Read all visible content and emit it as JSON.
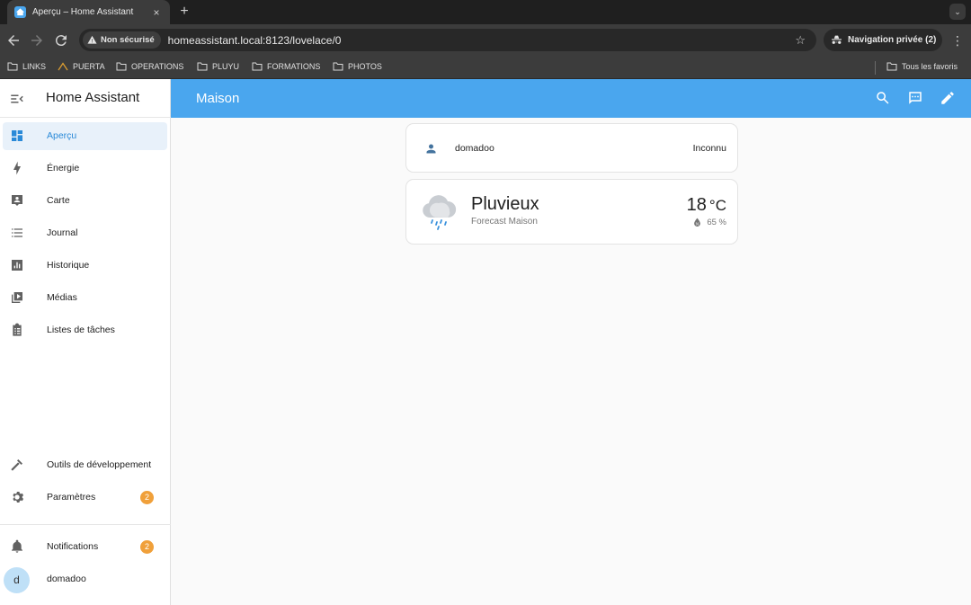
{
  "browser": {
    "tab_title": "Aperçu – Home Assistant",
    "tab_close": "×",
    "new_tab": "+",
    "security_label": "Non sécurisé",
    "url": "homeassistant.local:8123/lovelace/0",
    "private_label": "Navigation privée (2)",
    "bookmarks": [
      "LINKS",
      "PUERTA",
      "OPERATIONS",
      "PLUYU",
      "FORMATIONS",
      "PHOTOS"
    ],
    "all_bookmarks_label": "Tous les favoris"
  },
  "sidebar": {
    "title": "Home Assistant",
    "items": [
      {
        "label": "Aperçu",
        "icon": "dashboard-icon"
      },
      {
        "label": "Énergie",
        "icon": "lightning-bolt-icon"
      },
      {
        "label": "Carte",
        "icon": "map-account-icon"
      },
      {
        "label": "Journal",
        "icon": "list-icon"
      },
      {
        "label": "Historique",
        "icon": "chart-box-icon"
      },
      {
        "label": "Médias",
        "icon": "play-box-multiple-icon"
      },
      {
        "label": "Listes de tâches",
        "icon": "clipboard-list-icon"
      }
    ],
    "dev_tools_label": "Outils de développement",
    "settings_label": "Paramètres",
    "settings_badge": "2",
    "notifications_label": "Notifications",
    "notifications_badge": "2",
    "user_initial": "d",
    "user_name": "domadoo"
  },
  "header": {
    "title": "Maison"
  },
  "cards": {
    "person": {
      "name": "domadoo",
      "state": "Inconnu"
    },
    "weather": {
      "state": "Pluvieux",
      "name": "Forecast Maison",
      "temperature": "18",
      "unit": "°C",
      "humidity": "65 %"
    }
  },
  "colors": {
    "accent": "#4aa6ee",
    "active_text": "#2a8ad8",
    "badge": "#f0a03a"
  }
}
